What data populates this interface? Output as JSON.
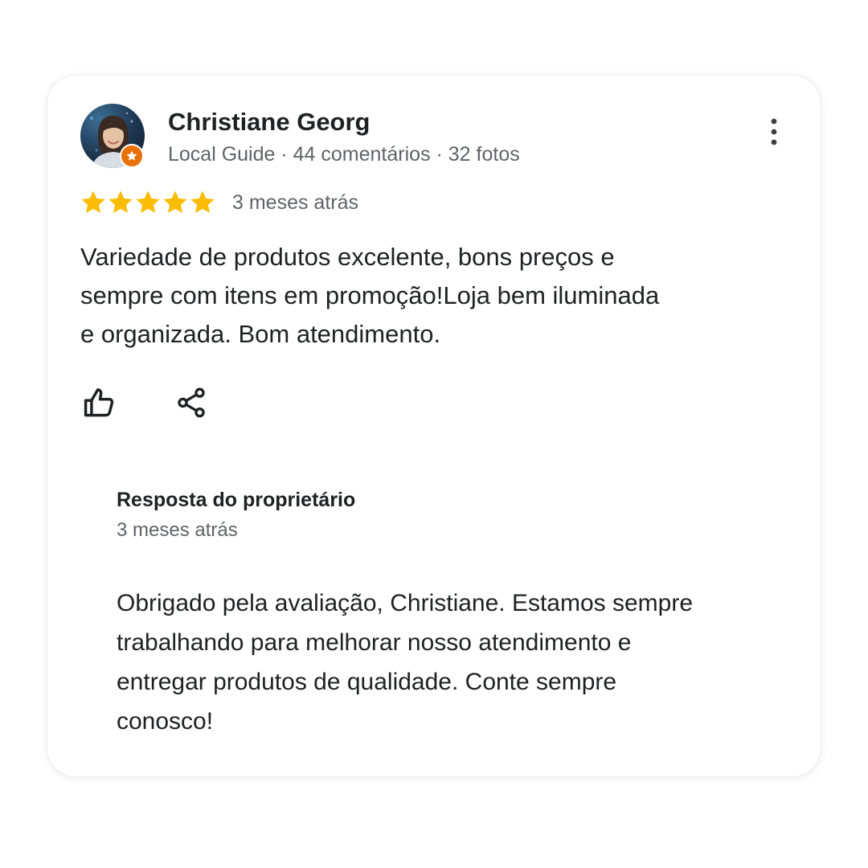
{
  "review": {
    "reviewer": {
      "name": "Christiane Georg",
      "meta": "Local Guide · 44 comentários · 32 fotos",
      "badge_icon": "local-guide-star-icon",
      "badge_color": "#e8710a"
    },
    "rating": {
      "value": 5,
      "max": 5,
      "star_color": "#fbbc04"
    },
    "date": "3 meses atrás",
    "text_lines": [
      "Variedade de produtos excelente, bons preços e",
      "sempre com itens em promoção!Loja bem iluminada",
      "e organizada. Bom atendimento."
    ],
    "actions": {
      "like_icon": "thumbs-up-icon",
      "share_icon": "share-icon",
      "more_icon": "more-vert-icon"
    }
  },
  "owner_response": {
    "title": "Resposta do proprietário",
    "date": "3 meses atrás",
    "text_lines": [
      "Obrigado pela avaliação, Christiane. Estamos sempre",
      "trabalhando para melhorar nosso atendimento e",
      "entregar produtos de qualidade. Conte sempre",
      "conosco!"
    ]
  }
}
